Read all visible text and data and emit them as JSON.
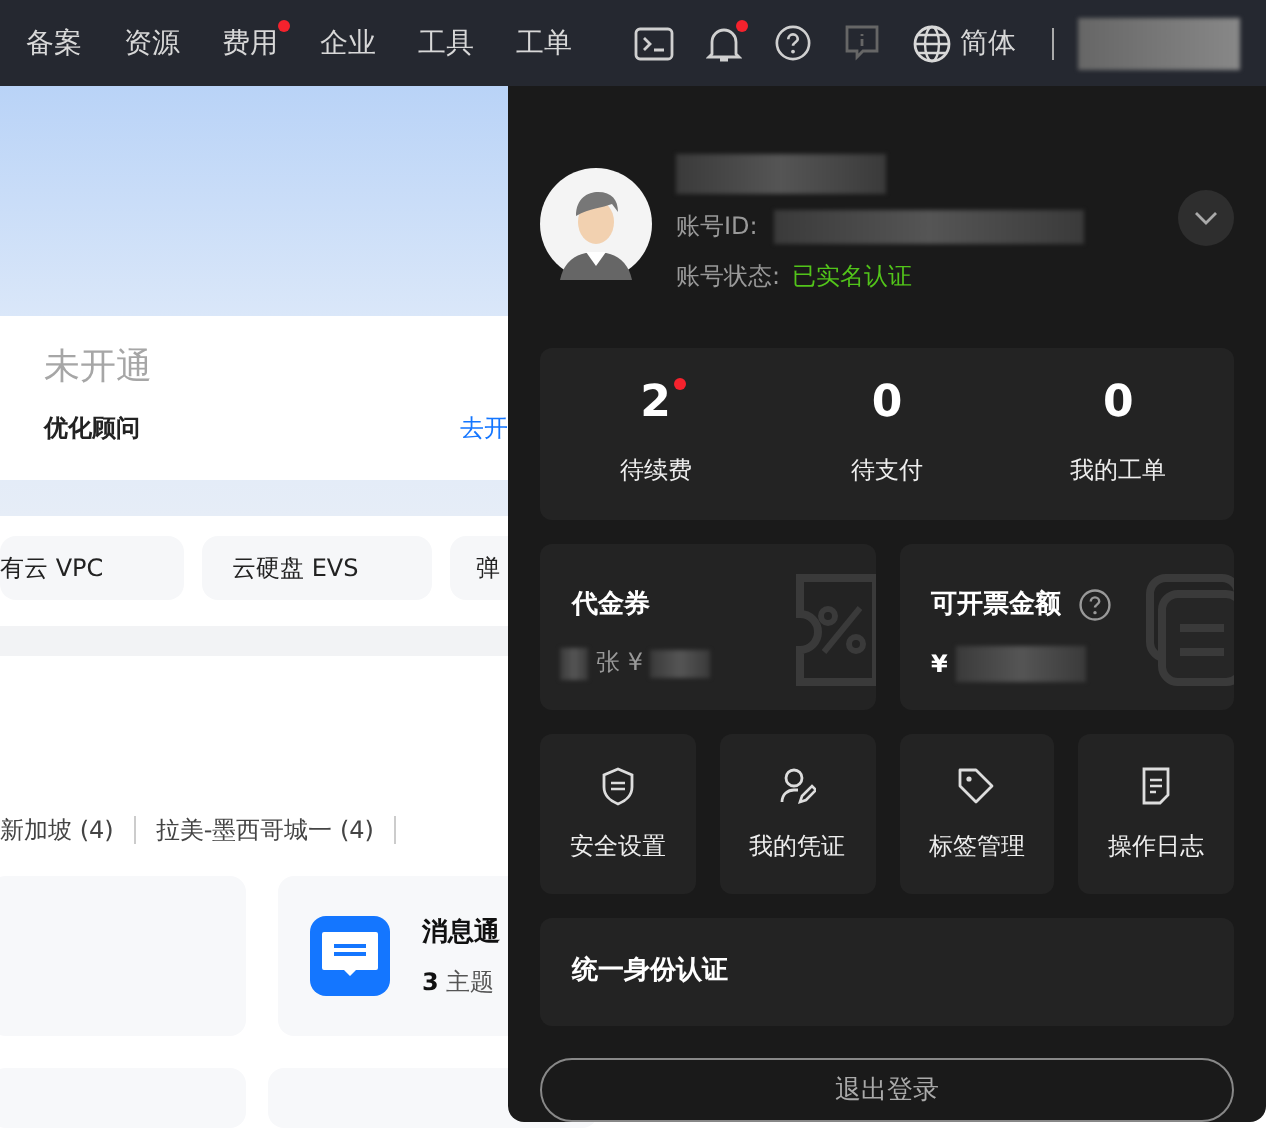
{
  "nav": {
    "items": [
      {
        "label": "备案",
        "badge": false
      },
      {
        "label": "资源",
        "badge": false
      },
      {
        "label": "费用",
        "badge": true
      },
      {
        "label": "企业",
        "badge": false
      },
      {
        "label": "工具",
        "badge": false
      },
      {
        "label": "工单",
        "badge": false
      }
    ],
    "icons": [
      {
        "kind": "terminal",
        "badge": false,
        "disabled": false
      },
      {
        "kind": "bell",
        "badge": true,
        "disabled": false
      },
      {
        "kind": "help",
        "badge": false,
        "disabled": false
      },
      {
        "kind": "feedback",
        "badge": false,
        "disabled": true
      }
    ],
    "language": "简体"
  },
  "background": {
    "card": {
      "status": "未开通",
      "label": "优化顾问",
      "link": "去开"
    },
    "chips": [
      "有云 VPC",
      "云硬盘 EVS",
      "弹"
    ],
    "regions": [
      "新加坡 (4)",
      "拉美-墨西哥城一 (4)"
    ],
    "topic_card": {
      "title": "消息通",
      "count": "3",
      "unit": "主题"
    }
  },
  "panel": {
    "account": {
      "id_label": "账号ID:",
      "status_label": "账号状态:",
      "status": "已实名认证"
    },
    "stats": [
      {
        "value": "2",
        "label": "待续费",
        "badge": true
      },
      {
        "value": "0",
        "label": "待支付",
        "badge": false
      },
      {
        "value": "0",
        "label": "我的工单",
        "badge": false
      }
    ],
    "voucher": {
      "title": "代金券",
      "unit": "张 ¥"
    },
    "invoice": {
      "title": "可开票金额",
      "currency": "¥"
    },
    "shortcuts": [
      {
        "kind": "shield",
        "label": "安全设置"
      },
      {
        "kind": "person-pen",
        "label": "我的凭证"
      },
      {
        "kind": "tag",
        "label": "标签管理"
      },
      {
        "kind": "document",
        "label": "操作日志"
      }
    ],
    "sso": "统一身份认证",
    "logout": "退出登录"
  }
}
